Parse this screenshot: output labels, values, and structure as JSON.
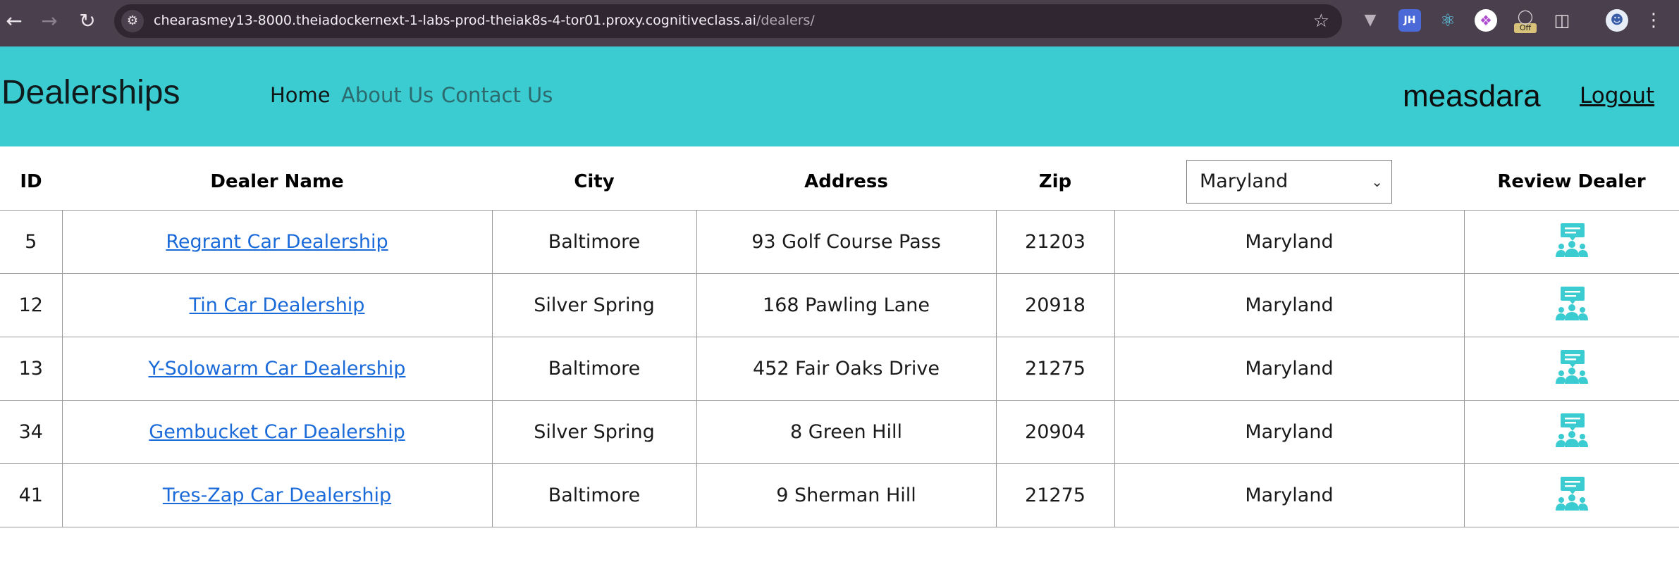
{
  "browser": {
    "url_host": "chearasmey13-8000.theiadockernext-1-labs-prod-theiak8s-4-tor01.proxy.cognitiveclass.ai",
    "url_path": "/dealers/",
    "extensions": [
      "vue-devtools-icon",
      "jh-extension-icon",
      "react-devtools-icon",
      "brain-extension-icon",
      "off-extension-icon",
      "puzzle-icon",
      "profile-avatar-icon",
      "kebab-menu-icon"
    ]
  },
  "header": {
    "brand": "Dealerships",
    "nav": [
      {
        "label": "Home",
        "active": true
      },
      {
        "label": "About Us",
        "active": false
      },
      {
        "label": "Contact Us",
        "active": false
      }
    ],
    "username": "measdara",
    "logout_label": "Logout",
    "background_color": "#3bccd2"
  },
  "table": {
    "columns": [
      "ID",
      "Dealer Name",
      "City",
      "Address",
      "Zip",
      "Review Dealer"
    ],
    "state_filter": {
      "selected": "Maryland"
    },
    "rows": [
      {
        "id": "5",
        "name": "Regrant Car Dealership",
        "city": "Baltimore",
        "address": "93 Golf Course Pass",
        "zip": "21203",
        "state": "Maryland"
      },
      {
        "id": "12",
        "name": "Tin Car Dealership",
        "city": "Silver Spring",
        "address": "168 Pawling Lane",
        "zip": "20918",
        "state": "Maryland"
      },
      {
        "id": "13",
        "name": "Y-Solowarm Car Dealership",
        "city": "Baltimore",
        "address": "452 Fair Oaks Drive",
        "zip": "21275",
        "state": "Maryland"
      },
      {
        "id": "34",
        "name": "Gembucket Car Dealership",
        "city": "Silver Spring",
        "address": "8 Green Hill",
        "zip": "20904",
        "state": "Maryland"
      },
      {
        "id": "41",
        "name": "Tres-Zap Car Dealership",
        "city": "Baltimore",
        "address": "9 Sherman Hill",
        "zip": "21275",
        "state": "Maryland"
      }
    ],
    "review_icon": "review-dealer-icon",
    "link_color": "#1a6ad9",
    "icon_color": "#3bccd2"
  }
}
